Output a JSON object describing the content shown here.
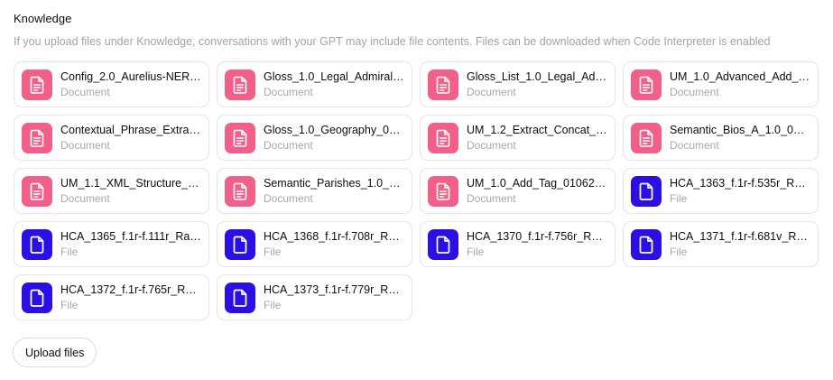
{
  "knowledge": {
    "title": "Knowledge",
    "description": "If you upload files under Knowledge, conversations with your GPT may include file contents. Files can be downloaded when Code Interpreter is enabled",
    "upload_label": "Upload files"
  },
  "icons": {
    "document": {
      "name": "document-icon",
      "color": "#f2608a"
    },
    "file": {
      "name": "file-icon",
      "color": "#2b10e6"
    }
  },
  "files": [
    {
      "name": "Config_2.0_Aurelius-NER_...",
      "type": "Document",
      "kind": "document"
    },
    {
      "name": "Gloss_1.0_Legal_Admiralty...",
      "type": "Document",
      "kind": "document"
    },
    {
      "name": "Gloss_List_1.0_Legal_Admi...",
      "type": "Document",
      "kind": "document"
    },
    {
      "name": "UM_1.0_Advanced_Add_T...",
      "type": "Document",
      "kind": "document"
    },
    {
      "name": "Contextual_Phrase_Extrac...",
      "type": "Document",
      "kind": "document"
    },
    {
      "name": "Gloss_1.0_Geography_020...",
      "type": "Document",
      "kind": "document"
    },
    {
      "name": "UM_1.2_Extract_Concat_fr...",
      "type": "Document",
      "kind": "document"
    },
    {
      "name": "Semantic_Bios_A_1.0_020...",
      "type": "Document",
      "kind": "document"
    },
    {
      "name": "UM_1.1_XML_Structure_M...",
      "type": "Document",
      "kind": "document"
    },
    {
      "name": "Semantic_Parishes_1.0_Lo...",
      "type": "Document",
      "kind": "document"
    },
    {
      "name": "UM_1.0_Add_Tag_0106202...",
      "type": "Document",
      "kind": "document"
    },
    {
      "name": "HCA_1363_f.1r-f.535r_Raw...",
      "type": "File",
      "kind": "file"
    },
    {
      "name": "HCA_1365_f.1r-f.111r_Raw_...",
      "type": "File",
      "kind": "file"
    },
    {
      "name": "HCA_1368_f.1r-f.708r_Raw...",
      "type": "File",
      "kind": "file"
    },
    {
      "name": "HCA_1370_f.1r-f.756r_Raw...",
      "type": "File",
      "kind": "file"
    },
    {
      "name": "HCA_1371_f.1r-f.681v_Raw_...",
      "type": "File",
      "kind": "file"
    },
    {
      "name": "HCA_1372_f.1r-f.765r_Raw...",
      "type": "File",
      "kind": "file"
    },
    {
      "name": "HCA_1373_f.1r-f.779r_Raw...",
      "type": "File",
      "kind": "file"
    }
  ]
}
